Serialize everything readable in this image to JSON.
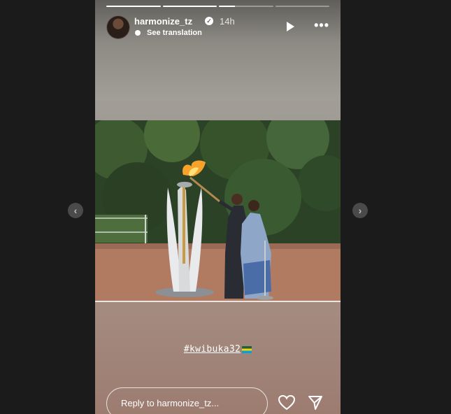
{
  "story": {
    "progress": [
      1,
      1,
      0.3,
      0,
      0
    ],
    "username": "harmonize_tz",
    "time": "14h",
    "see_translation": "See translation",
    "hashtag": "#kwibuka32",
    "reply_placeholder": "Reply to harmonize_tz..."
  },
  "icons": [
    "verified-badge-icon",
    "translate-icon",
    "play-icon",
    "more-icon",
    "heart-icon",
    "send-icon",
    "chevron-left-icon",
    "chevron-right-icon"
  ]
}
